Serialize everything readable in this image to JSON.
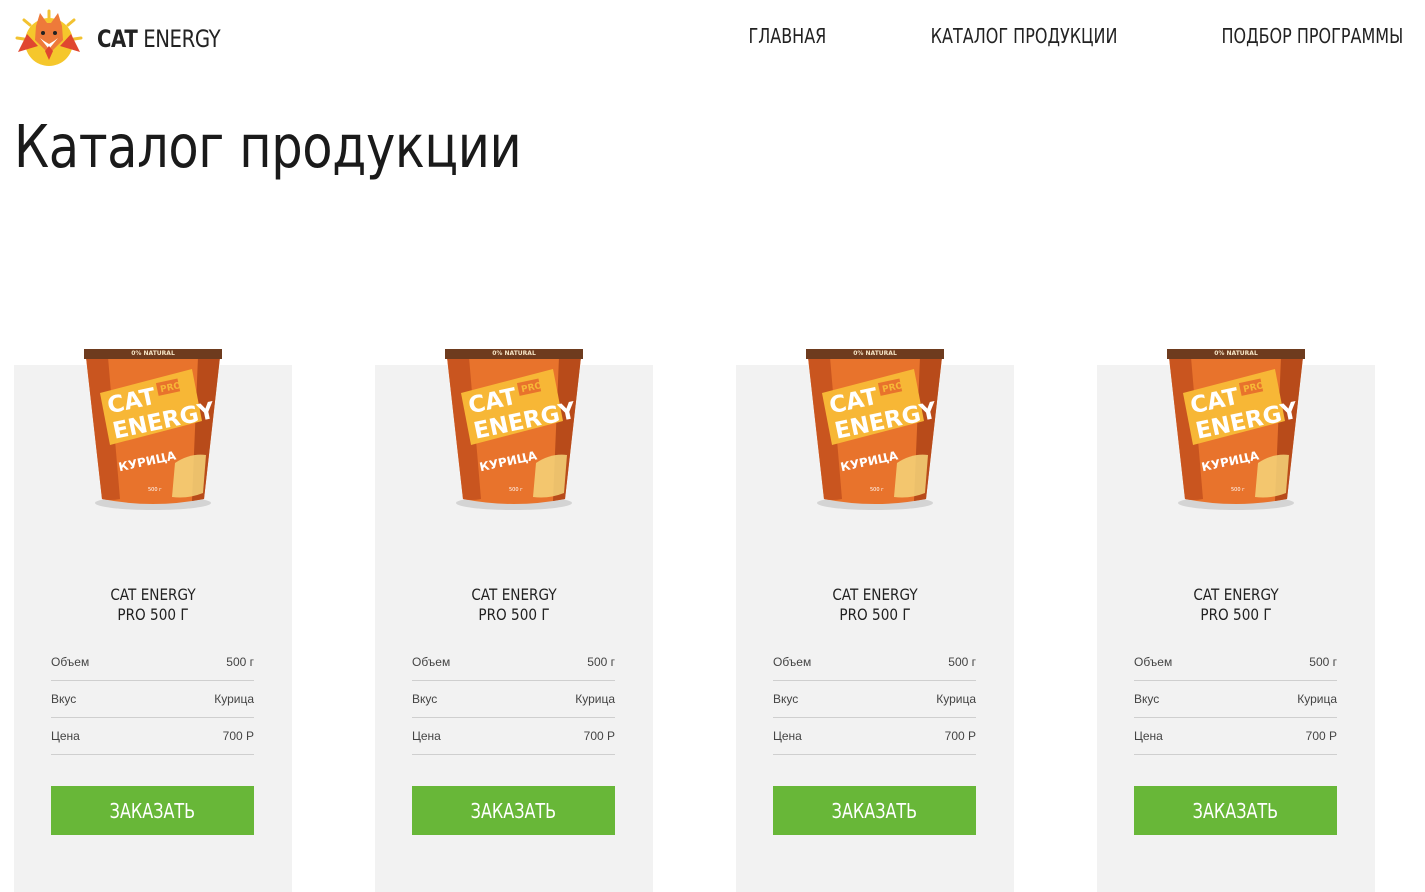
{
  "header": {
    "logo": {
      "word1": "CAT",
      "word2": "ENERGY"
    },
    "nav": [
      {
        "label": "ГЛАВНАЯ"
      },
      {
        "label": "КАТАЛОГ ПРОДУКЦИИ"
      },
      {
        "label": "ПОДБОР ПРОГРАММЫ"
      }
    ]
  },
  "main": {
    "title": "Каталог продукции"
  },
  "package": {
    "badge": "0% NATURAL",
    "brand1": "CAT",
    "pro": "PRO",
    "brand2": "ENERGY",
    "flavor": "КУРИЦА",
    "weight": "500 г"
  },
  "products": [
    {
      "name_line1": "CAT ENERGY",
      "name_line2": "PRO 500 Г",
      "specs": [
        {
          "label": "Объем",
          "value": "500 г"
        },
        {
          "label": "Вкус",
          "value": "Курица"
        },
        {
          "label": "Цена",
          "value": "700 Р"
        }
      ],
      "button": "ЗАКАЗАТЬ"
    },
    {
      "name_line1": "CAT ENERGY",
      "name_line2": "PRO 500 Г",
      "specs": [
        {
          "label": "Объем",
          "value": "500 г"
        },
        {
          "label": "Вкус",
          "value": "Курица"
        },
        {
          "label": "Цена",
          "value": "700 Р"
        }
      ],
      "button": "ЗАКАЗАТЬ"
    },
    {
      "name_line1": "CAT ENERGY",
      "name_line2": "PRO 500 Г",
      "specs": [
        {
          "label": "Объем",
          "value": "500 г"
        },
        {
          "label": "Вкус",
          "value": "Курица"
        },
        {
          "label": "Цена",
          "value": "700 Р"
        }
      ],
      "button": "ЗАКАЗАТЬ"
    },
    {
      "name_line1": "CAT ENERGY",
      "name_line2": "PRO 500 Г",
      "specs": [
        {
          "label": "Объем",
          "value": "500 г"
        },
        {
          "label": "Вкус",
          "value": "Курица"
        },
        {
          "label": "Цена",
          "value": "700 Р"
        }
      ],
      "button": "ЗАКАЗАТЬ"
    }
  ],
  "colors": {
    "accent": "#68b738",
    "card": "#f2f2f2",
    "package": "#e8732c"
  }
}
